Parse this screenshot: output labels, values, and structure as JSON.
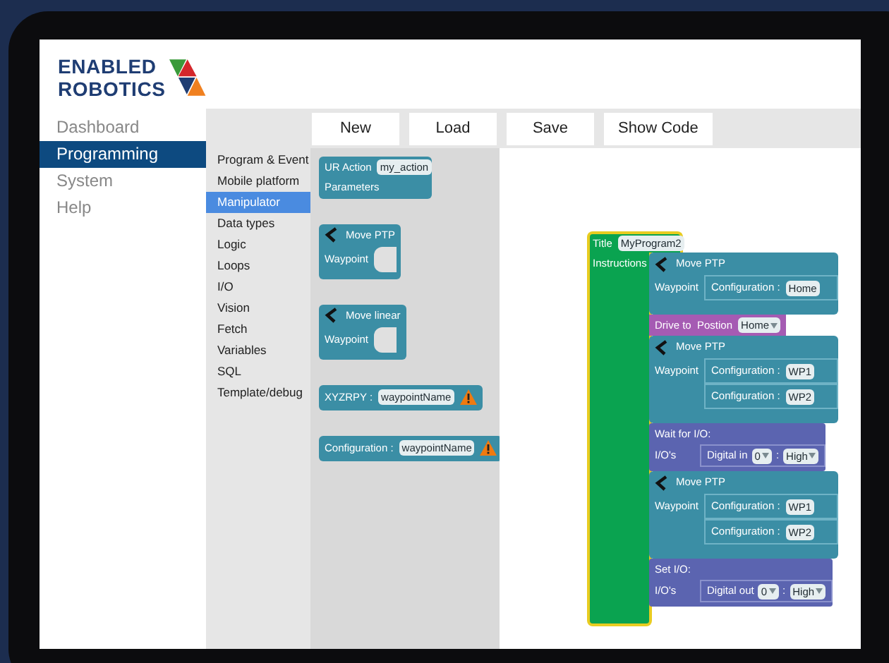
{
  "logo": {
    "line1": "ENABLED",
    "line2": "ROBOTICS"
  },
  "nav": [
    {
      "label": "Dashboard",
      "selected": false
    },
    {
      "label": "Programming",
      "selected": true
    },
    {
      "label": "System",
      "selected": false
    },
    {
      "label": "Help",
      "selected": false
    }
  ],
  "toolbar_buttons": [
    "New",
    "Load",
    "Save",
    "Show Code"
  ],
  "categories": [
    {
      "label": "Program & Event",
      "selected": false
    },
    {
      "label": "Mobile platform",
      "selected": false
    },
    {
      "label": "Manipulator",
      "selected": true
    },
    {
      "label": "Data types",
      "selected": false
    },
    {
      "label": "Logic",
      "selected": false
    },
    {
      "label": "Loops",
      "selected": false
    },
    {
      "label": "I/O",
      "selected": false
    },
    {
      "label": "Vision",
      "selected": false
    },
    {
      "label": "Fetch",
      "selected": false
    },
    {
      "label": "Variables",
      "selected": false
    },
    {
      "label": "SQL",
      "selected": false
    },
    {
      "label": "Template/debug",
      "selected": false
    }
  ],
  "flyout_blocks": [
    {
      "kind": "action",
      "label": "UR Action",
      "field": "my_action",
      "input": "Parameters"
    },
    {
      "kind": "move",
      "label": "Move PTP",
      "input": "Waypoint"
    },
    {
      "kind": "move",
      "label": "Move linear",
      "input": "Waypoint"
    },
    {
      "kind": "value",
      "label": "XYZRPY :",
      "field": "waypointName",
      "warning": true
    },
    {
      "kind": "value",
      "label": "Configuration :",
      "field": "waypointName",
      "warning": true
    }
  ],
  "program": {
    "title_label": "Title",
    "title": "MyProgram2",
    "instructions_label": "Instructions",
    "statements": [
      {
        "kind": "move",
        "label": "Move PTP",
        "input": "Waypoint",
        "configs": [
          {
            "label": "Configuration :",
            "value": "Home"
          }
        ]
      },
      {
        "kind": "drive",
        "label": "Drive to  Postion",
        "value": "Home"
      },
      {
        "kind": "move",
        "label": "Move PTP",
        "input": "Waypoint",
        "configs": [
          {
            "label": "Configuration :",
            "value": "WP1"
          },
          {
            "label": "Configuration :",
            "value": "WP2"
          }
        ]
      },
      {
        "kind": "io",
        "label": "Wait for I/O:",
        "input": "I/O's",
        "signal": "Digital in",
        "port": "0",
        "separator": ":",
        "state": "High"
      },
      {
        "kind": "move",
        "label": "Move PTP",
        "input": "Waypoint",
        "configs": [
          {
            "label": "Configuration :",
            "value": "WP1"
          },
          {
            "label": "Configuration :",
            "value": "WP2"
          }
        ]
      },
      {
        "kind": "io",
        "label": "Set I/O:",
        "input": "I/O's",
        "signal": "Digital out",
        "port": "0",
        "separator": ":",
        "state": "High"
      }
    ]
  }
}
